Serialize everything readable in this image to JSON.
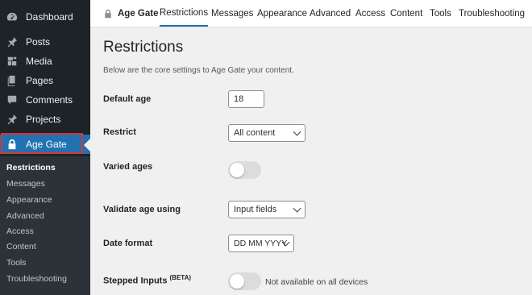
{
  "sidebar": {
    "menu": [
      {
        "label": "Dashboard",
        "icon": "dashboard-icon"
      },
      {
        "label": "Posts",
        "icon": "pin-icon"
      },
      {
        "label": "Media",
        "icon": "media-icon"
      },
      {
        "label": "Pages",
        "icon": "pages-icon"
      },
      {
        "label": "Comments",
        "icon": "comment-icon"
      },
      {
        "label": "Projects",
        "icon": "pin-icon"
      },
      {
        "label": "Age Gate",
        "icon": "lock-icon"
      }
    ],
    "submenu": [
      "Restrictions",
      "Messages",
      "Appearance",
      "Advanced",
      "Access",
      "Content",
      "Tools",
      "Troubleshooting"
    ]
  },
  "topnav": {
    "brand": "Age Gate",
    "tabs": [
      "Restrictions",
      "Messages",
      "Appearance",
      "Advanced",
      "Access",
      "Content",
      "Tools",
      "Troubleshooting"
    ]
  },
  "page": {
    "title": "Restrictions",
    "description": "Below are the core settings to Age Gate your content.",
    "fields": {
      "default_age": {
        "label": "Default age",
        "value": "18"
      },
      "restrict": {
        "label": "Restrict",
        "value": "All content"
      },
      "varied_ages": {
        "label": "Varied ages"
      },
      "validate": {
        "label": "Validate age using",
        "value": "Input fields"
      },
      "date_format": {
        "label": "Date format",
        "value": "DD MM YYYY"
      },
      "stepped": {
        "label": "Stepped Inputs",
        "sup": "(BETA)",
        "note": "Not available on all devices"
      }
    }
  },
  "colors": {
    "accent": "#2271b1",
    "sidebar_bg": "#1d2327",
    "highlight": "#d63638"
  }
}
